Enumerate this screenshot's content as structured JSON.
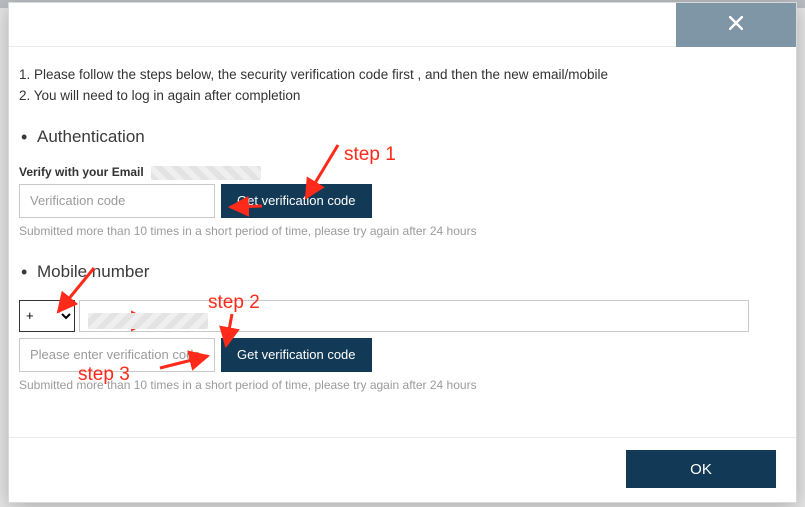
{
  "instructions": {
    "line1": "1. Please follow the steps below, the security verification code first , and then the new email/mobile",
    "line2": "2. You will need to log in again after completion"
  },
  "auth_section": {
    "title": "Authentication",
    "verify_label_prefix": "Verify with your Email",
    "code_placeholder": "Verification code",
    "get_code_label": "Get verification code",
    "rate_limit_hint": "Submitted more than 10 times in a short period of time, please try again after 24 hours"
  },
  "mobile_section": {
    "title": "Mobile number",
    "country_prefix": "+",
    "phone_value": "",
    "code_placeholder": "Please enter verification code",
    "get_code_label": "Get verification code",
    "rate_limit_hint": "Submitted more than 10 times in a short period of time, please try again after 24 hours"
  },
  "footer": {
    "ok_label": "OK"
  },
  "annotations": {
    "step1": "step 1",
    "step2": "step 2",
    "step3": "step 3"
  },
  "colors": {
    "primary": "#123a56",
    "annotation": "#ff2a1a",
    "close_bg": "#7f96a6"
  }
}
